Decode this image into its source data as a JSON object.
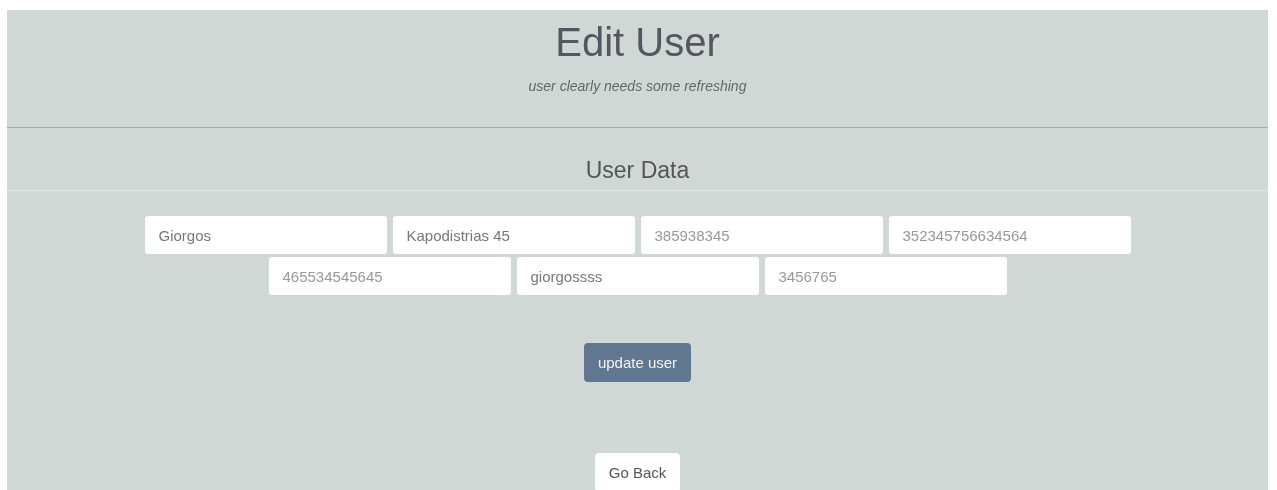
{
  "header": {
    "title": "Edit User",
    "subtitle": "user clearly needs some refreshing"
  },
  "section": {
    "title": "User Data"
  },
  "fields": [
    {
      "value": "Giorgos"
    },
    {
      "value": "Kapodistrias 45"
    },
    {
      "placeholder": "385938345"
    },
    {
      "placeholder": "352345756634564"
    },
    {
      "placeholder": "465534545645"
    },
    {
      "value": "giorgossss"
    },
    {
      "placeholder": "3456765"
    }
  ],
  "buttons": [
    {
      "kind": "primary",
      "label": "update user"
    },
    {
      "kind": "secondary",
      "label": "Go Back"
    }
  ]
}
